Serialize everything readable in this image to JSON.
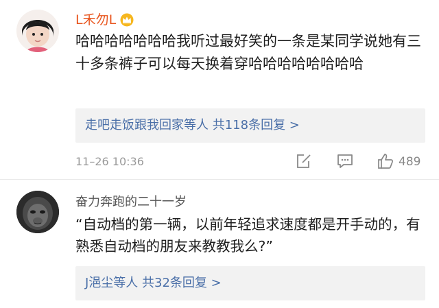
{
  "comments": [
    {
      "username": "L禾勿L",
      "badge_icon": "crown-badge-icon",
      "text": "哈哈哈哈哈哈哈我听过最好笑的一条是某同学说她有三十多条裤子可以每天换着穿哈哈哈哈哈哈哈哈",
      "replies_summary": "走吧走饭跟我回家等人  共118条回复 >",
      "timestamp": "11–26 10:36",
      "like_count": "489"
    },
    {
      "username": "奋力奔跑的二十一岁",
      "text": "“自动档的第一辆，以前年轻追求速度都是开手动的，有熟悉自动档的朋友来教教我么?”",
      "replies_summary": "J浥尘等人  共32条回复 >"
    }
  ],
  "colors": {
    "username_vip": "#e8561f",
    "username_normal": "#555555",
    "link_blue": "#4a6fa8",
    "reply_bg": "#f2f2f2",
    "meta_gray": "#9a9a9a"
  }
}
